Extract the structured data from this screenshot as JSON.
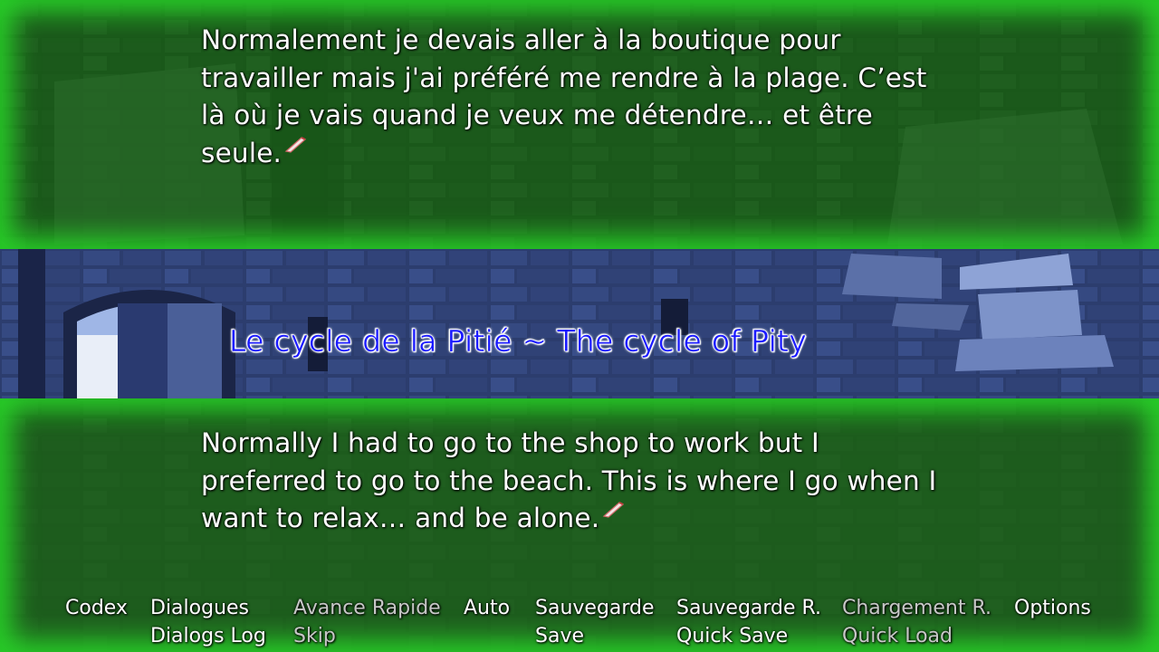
{
  "dialog": {
    "french_lines": [
      "Normalement je devais aller à la boutique pour",
      "travailler mais j'ai préféré me rendre à la plage. C’est",
      "là où je vais quand je veux me détendre… et être",
      "seule."
    ],
    "english_lines": [
      "Normally I had to go to the shop to work but I",
      "preferred to go to the beach. This is where I go when I",
      "want to relax… and be alone."
    ],
    "continue_icon": "quill-icon"
  },
  "chapter": {
    "title": "Le cycle de la Pitié ~ The cycle of Pity"
  },
  "quick_menu": {
    "codex": "Codex",
    "dialogues_fr": "Dialogues",
    "dialogues_en": "Dialogs Log",
    "skip_fr": "Avance Rapide",
    "skip_en": "Skip",
    "auto": "Auto",
    "save_fr": "Sauvegarde",
    "save_en": "Save",
    "qsave_fr": "Sauvegarde R.",
    "qsave_en": "Quick Save",
    "qload_fr": "Chargement R.",
    "qload_en": "Quick Load",
    "options": "Options"
  },
  "colors": {
    "panel_glow": "#28d228",
    "panel_fill": "#0a6e0a",
    "title_text": "#1a1aff",
    "strip_tint": "#3a4f8f",
    "dim_menu": "#c7c7c7"
  }
}
